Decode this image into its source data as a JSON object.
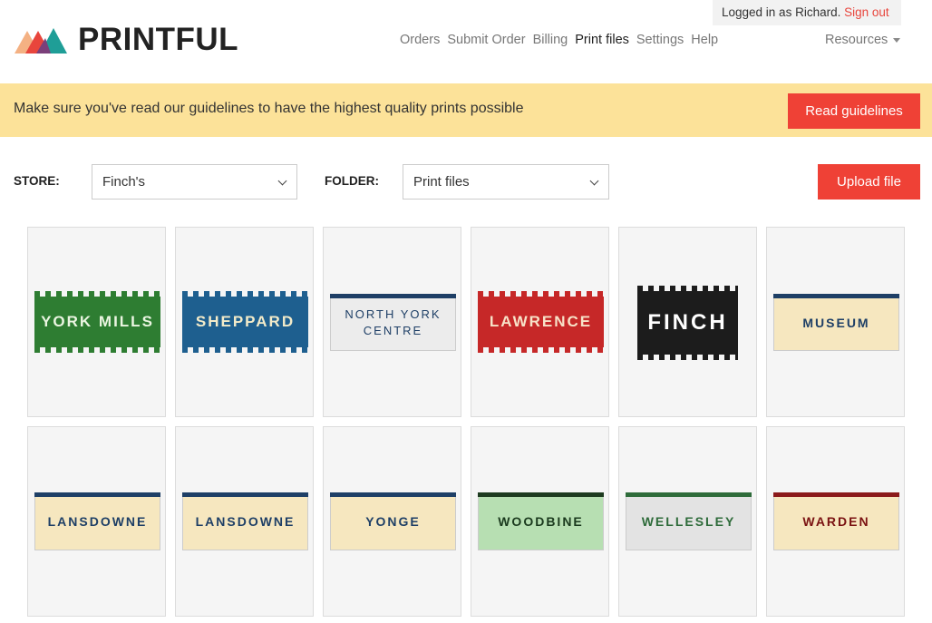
{
  "header": {
    "logo_text": "PRINTFUL",
    "login_text": "Logged in as Richard.",
    "signout": "Sign out",
    "nav": [
      "Orders",
      "Submit Order",
      "Billing",
      "Print files",
      "Settings",
      "Help"
    ],
    "active_nav": "Print files",
    "resources": "Resources"
  },
  "notice": {
    "text": "Make sure you've read our guidelines to have the highest quality prints possible",
    "button": "Read guidelines"
  },
  "filters": {
    "store_label": "STORE:",
    "store_value": "Finch's",
    "folder_label": "FOLDER:",
    "folder_value": "Print files",
    "upload_button": "Upload file"
  },
  "files": [
    {
      "name": "YORK MILLS",
      "style": "mosaic",
      "bg": "#2e7d32",
      "fg": "#eaf5e1"
    },
    {
      "name": "SHEPPARD",
      "style": "mosaic",
      "bg": "#1e5f8f",
      "fg": "#f3ebc9"
    },
    {
      "name": "NORTH YORK\nCENTRE",
      "style": "stripe",
      "bg": "#ececec",
      "fg": "#1e3f66",
      "bar": "#1e3f66"
    },
    {
      "name": "LAWRENCE",
      "style": "mosaic",
      "bg": "#c62828",
      "fg": "#f7e2c8"
    },
    {
      "name": "FINCH",
      "style": "mosaic",
      "bg": "#1c1c1c",
      "fg": "#ffffff"
    },
    {
      "name": "MUSEUM",
      "style": "stripe",
      "bg": "#f6e7bf",
      "fg": "#1e3f66",
      "bar": "#1e3f66"
    },
    {
      "name": "LANSDOWNE",
      "style": "stripe",
      "bg": "#f6e7bf",
      "fg": "#1e3f66",
      "bar": "#1e3f66"
    },
    {
      "name": "LANSDOWNE",
      "style": "stripe",
      "bg": "#f6e7bf",
      "fg": "#1e3f66",
      "bar": "#1e3f66"
    },
    {
      "name": "YONGE",
      "style": "stripe",
      "bg": "#f6e7bf",
      "fg": "#1e3f66",
      "bar": "#1e3f66"
    },
    {
      "name": "WOODBINE",
      "style": "stripe",
      "bg": "#b7dfb2",
      "fg": "#1b3a1e",
      "bar": "#1d3a1f"
    },
    {
      "name": "WELLESLEY",
      "style": "stripe",
      "bg": "#e3e3e3",
      "fg": "#2e6b3a",
      "bar": "#2e6b3a"
    },
    {
      "name": "WARDEN",
      "style": "stripe",
      "bg": "#f6e7bf",
      "fg": "#7a1212",
      "bar": "#8b1a1a"
    }
  ],
  "colors": {
    "accent": "#ef4136",
    "notice_bg": "#fce299",
    "card_bg": "#f5f5f5"
  }
}
